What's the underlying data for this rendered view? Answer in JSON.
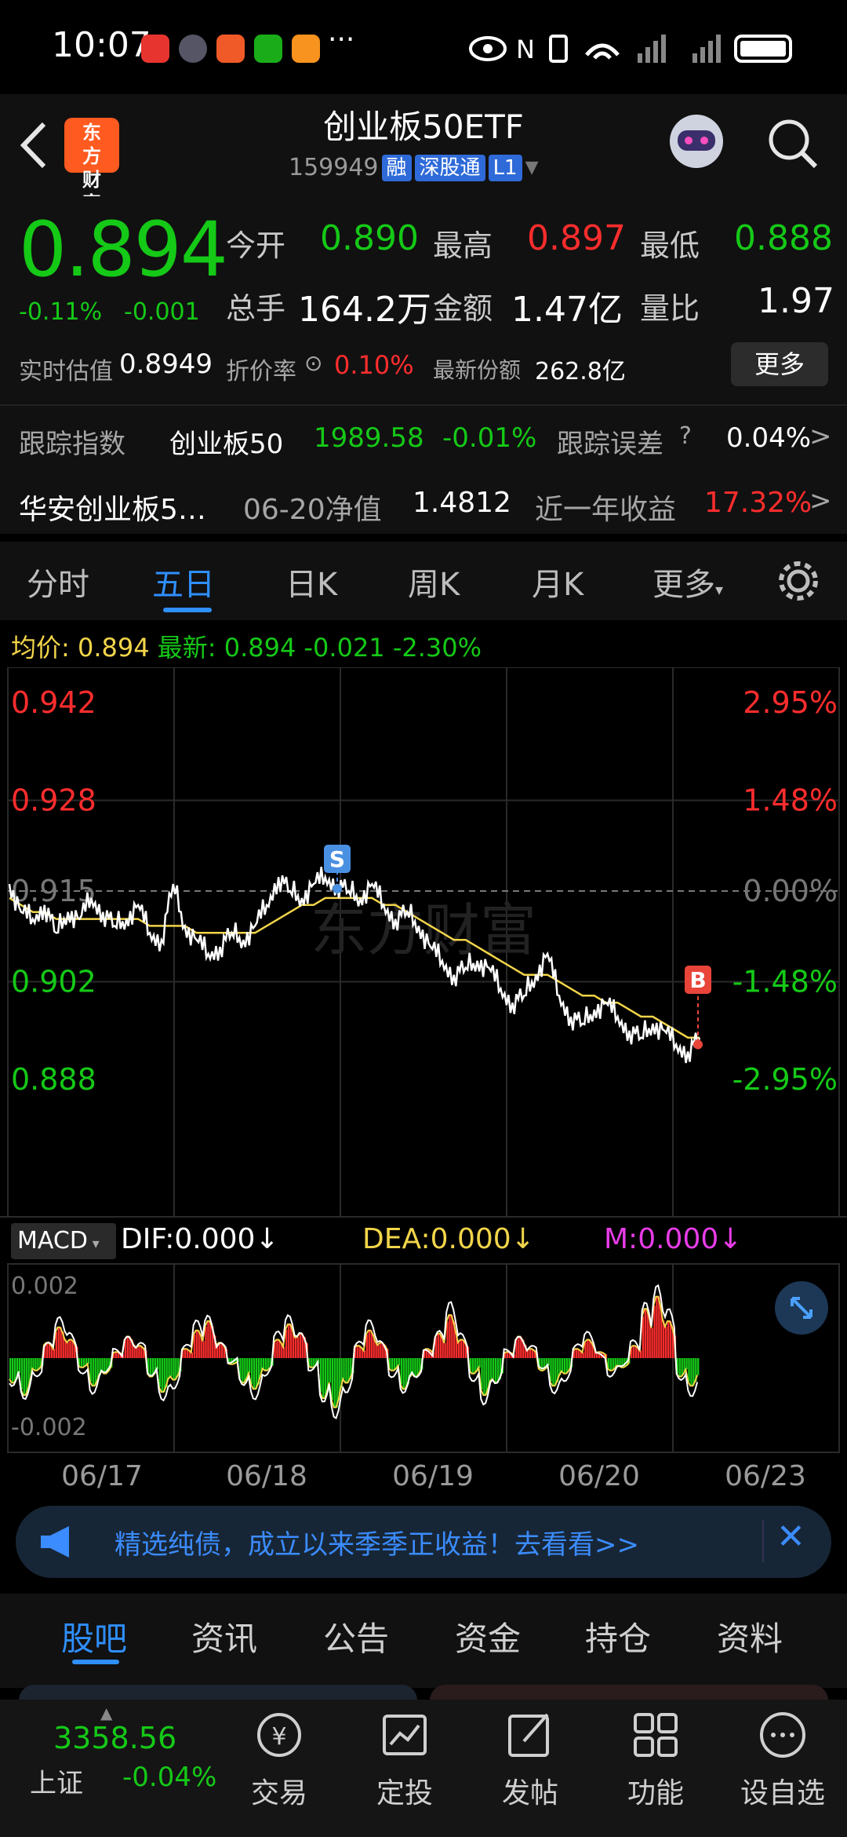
{
  "status_bar": {
    "time": "10:07",
    "more": "···"
  },
  "header": {
    "logo_text": "东方财富",
    "title": "创业板50ETF",
    "code": "159949",
    "tags": [
      "融",
      "深股通",
      "L1"
    ]
  },
  "quote": {
    "price": "0.894",
    "change_pct": "-0.11%",
    "change": "-0.001",
    "open_label": "今开",
    "open": "0.890",
    "high_label": "最高",
    "high": "0.897",
    "low_label": "最低",
    "low": "0.888",
    "volume_label": "总手",
    "volume": "164.2万",
    "amount_label": "金额",
    "amount": "1.47亿",
    "ratio_label": "量比",
    "ratio": "1.97",
    "iopv_label": "实时估值",
    "iopv": "0.8949",
    "discount_label": "折价率",
    "discount": "0.10%",
    "shares_label": "最新份额",
    "shares": "262.8亿",
    "more_btn": "更多",
    "track_label": "跟踪指数",
    "track_name": "创业板50",
    "track_value": "1989.58",
    "track_pct": "-0.01%",
    "error_label": "跟踪误差",
    "error_value": "0.04%",
    "fund_name": "华安创业板5…",
    "nav_label": "06-20净值",
    "nav_value": "1.4812",
    "year_label": "近一年收益",
    "year_value": "17.32%"
  },
  "tabs": [
    "分时",
    "五日",
    "日K",
    "周K",
    "月K",
    "更多"
  ],
  "chart_header": {
    "avg_label": "均价:",
    "avg": "0.894",
    "latest_label": "最新:",
    "latest": "0.894",
    "chg": "-0.021",
    "chg_pct": "-2.30%"
  },
  "chart_data": {
    "type": "line",
    "y_left": [
      "0.942",
      "0.928",
      "0.915",
      "0.902",
      "0.888"
    ],
    "y_right": [
      "2.95%",
      "1.48%",
      "0.00%",
      "-1.48%",
      "-2.95%"
    ],
    "dates": [
      "06/17",
      "06/18",
      "06/19",
      "06/20",
      "06/23"
    ],
    "sell_marker": "S",
    "buy_marker": "B",
    "watermark": "东方财富",
    "price_series": [
      0.916,
      0.912,
      0.911,
      0.913,
      0.909,
      0.912,
      0.911,
      0.914,
      0.912,
      0.91,
      0.911,
      0.913,
      0.909,
      0.908,
      0.916,
      0.91,
      0.908,
      0.906,
      0.907,
      0.909,
      0.908,
      0.91,
      0.913,
      0.917,
      0.915,
      0.914,
      0.916,
      0.917,
      0.916,
      0.915,
      0.914,
      0.916,
      0.913,
      0.911,
      0.912,
      0.91,
      0.907,
      0.905,
      0.903,
      0.904,
      0.905,
      0.904,
      0.901,
      0.899,
      0.9,
      0.903,
      0.906,
      0.9,
      0.897,
      0.896,
      0.898,
      0.899,
      0.897,
      0.895,
      0.894,
      0.896,
      0.895,
      0.893,
      0.892,
      0.894
    ],
    "avg_series": [
      0.914,
      0.913,
      0.912,
      0.912,
      0.911,
      0.911,
      0.911,
      0.911,
      0.911,
      0.911,
      0.911,
      0.911,
      0.91,
      0.91,
      0.91,
      0.91,
      0.909,
      0.909,
      0.909,
      0.909,
      0.909,
      0.909,
      0.91,
      0.911,
      0.912,
      0.913,
      0.913,
      0.914,
      0.914,
      0.914,
      0.914,
      0.914,
      0.913,
      0.913,
      0.912,
      0.911,
      0.91,
      0.909,
      0.908,
      0.908,
      0.907,
      0.906,
      0.905,
      0.904,
      0.903,
      0.903,
      0.903,
      0.902,
      0.901,
      0.9,
      0.9,
      0.899,
      0.899,
      0.898,
      0.897,
      0.897,
      0.896,
      0.895,
      0.894,
      0.894
    ],
    "macd_label": "MACD",
    "dif": "DIF:0.000",
    "dea": "DEA:0.000",
    "m": "M:0.000",
    "macd_top": "0.002",
    "macd_bottom": "-0.002",
    "macd_hist": [
      -0.8,
      -1.2,
      -0.4,
      0.5,
      1.0,
      0.6,
      -0.3,
      -0.9,
      -0.5,
      0.2,
      0.7,
      0.4,
      -0.6,
      -1.1,
      -0.7,
      0.3,
      0.9,
      1.2,
      0.5,
      -0.2,
      -0.8,
      -1.0,
      -0.4,
      0.6,
      1.1,
      0.8,
      -0.3,
      -1.3,
      -1.6,
      -0.8,
      0.4,
      0.9,
      0.5,
      -0.4,
      -1.0,
      -0.6,
      0.3,
      0.8,
      1.4,
      0.6,
      -0.5,
      -1.2,
      -0.8,
      0.2,
      0.7,
      0.3,
      -0.4,
      -0.9,
      -0.5,
      0.3,
      0.6,
      0.2,
      -0.4,
      -0.3,
      0.4,
      1.6,
      2.0,
      1.2,
      -0.6,
      -0.9
    ]
  },
  "banner": {
    "text": "精选纯债，成立以来季季正收益！去看看>>"
  },
  "subtabs": [
    "股吧",
    "资讯",
    "公告",
    "资金",
    "持仓",
    "资料"
  ],
  "bottom_nav": {
    "index_value": "3358.56",
    "index_name": "上证",
    "index_pct": "-0.04%",
    "items": [
      "交易",
      "定投",
      "发帖",
      "功能",
      "设自选"
    ]
  },
  "colors": {
    "up": "#ff2d2d",
    "down": "#15c917",
    "accent": "#2f8fff",
    "avg": "#f2d54a"
  }
}
